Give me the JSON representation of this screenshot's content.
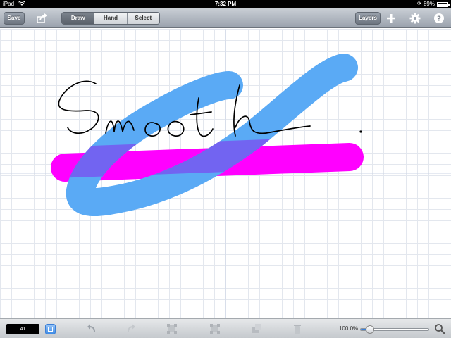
{
  "status_bar": {
    "device": "iPad",
    "time": "7:32 PM",
    "battery": "89%",
    "battery_level": 0.89
  },
  "toolbar": {
    "save_label": "Save",
    "modes": [
      {
        "label": "Draw",
        "active": true
      },
      {
        "label": "Hand",
        "active": false
      },
      {
        "label": "Select",
        "active": false
      }
    ],
    "layers_label": "Layers",
    "icons": [
      "share-icon",
      "add-icon",
      "gear-icon",
      "help-icon"
    ]
  },
  "bottom_bar": {
    "brush_size": "41",
    "zoom_label": "100.0%",
    "zoom_level": 0.14,
    "icons": [
      "undo-icon",
      "redo-icon",
      "transform-icon",
      "transform-disabled-icon",
      "layer-copy-icon",
      "trash-icon",
      "magnifier-icon"
    ]
  },
  "colors": {
    "blue_stroke": "#5aaaf5",
    "magenta_stroke": "#ff00ff",
    "overlap": "#7b4df0",
    "ink": "#000000",
    "accent": "#3a7fd8"
  }
}
